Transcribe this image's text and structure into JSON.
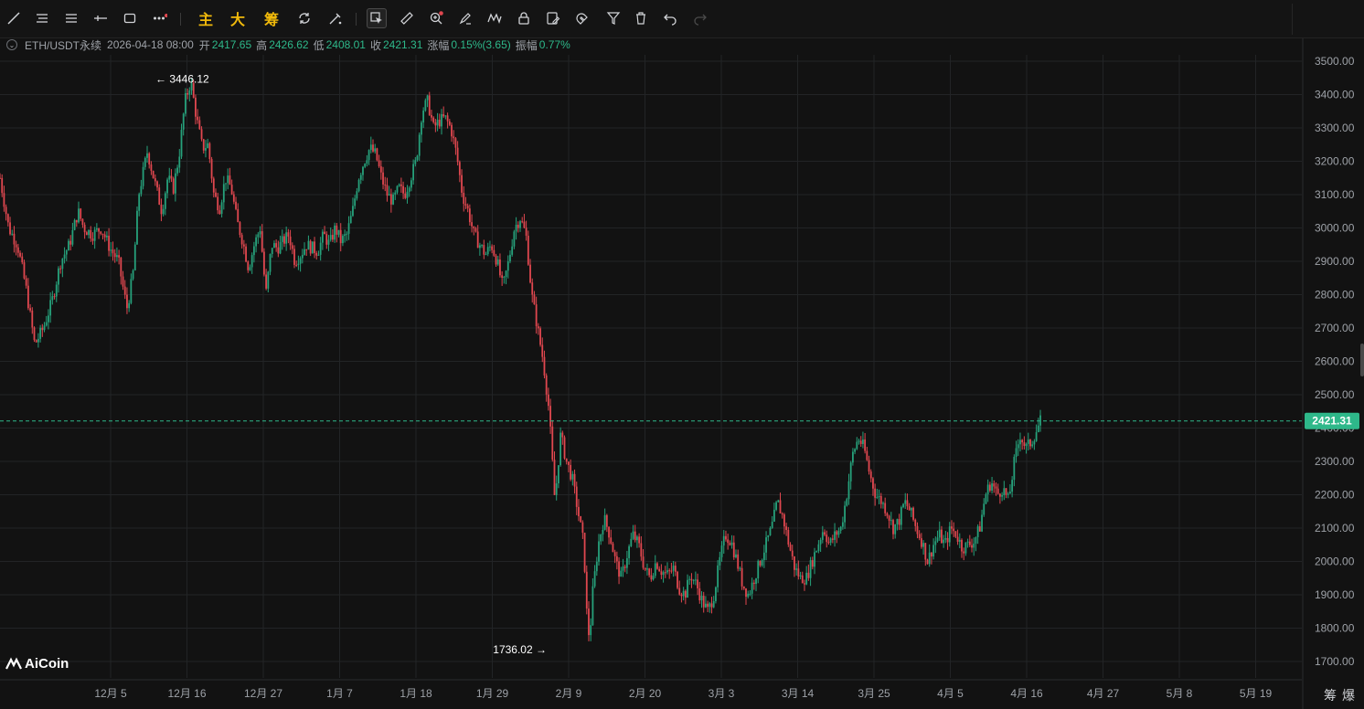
{
  "toolbar": {
    "tools": [
      {
        "name": "line-tool-icon"
      },
      {
        "name": "parallel-lines-icon"
      },
      {
        "name": "horizontal-lines-icon"
      },
      {
        "name": "horizontal-ray-icon"
      },
      {
        "name": "rectangle-icon"
      },
      {
        "name": "more-tools-icon"
      }
    ],
    "main_label": "主",
    "big_label": "大",
    "chip_label": "筹",
    "active_tool": "cursor-select-icon"
  },
  "info": {
    "symbol": "ETH/USDT永续",
    "datetime": "2026-04-18 08:00",
    "open_label": "开",
    "open": "2417.65",
    "high_label": "高",
    "high": "2426.62",
    "low_label": "低",
    "low": "2408.01",
    "close_label": "收",
    "close": "2421.31",
    "change_label": "涨幅",
    "change": "0.15%(3.65)",
    "amplitude_label": "振幅",
    "amplitude": "0.77%"
  },
  "logo_text": "AiCoin",
  "corner_labels": "筹爆",
  "colors": {
    "up": "#26a17b",
    "down": "#e0474f",
    "bg": "#121212",
    "grid": "#222426",
    "accent": "#2eb88a"
  },
  "chart_data": {
    "type": "candlestick",
    "y_axis": {
      "min": 1700,
      "max": 3500,
      "ticks": [
        "3500.00",
        "3400.00",
        "3300.00",
        "3200.00",
        "3100.00",
        "3000.00",
        "2900.00",
        "2800.00",
        "2700.00",
        "2600.00",
        "2500.00",
        "2400.00",
        "2300.00",
        "2200.00",
        "2100.00",
        "2000.00",
        "1900.00",
        "1800.00",
        "1700.00"
      ]
    },
    "x_axis": {
      "ticks": [
        "12月 5",
        "12月 16",
        "12月 27",
        "1月 7",
        "1月 18",
        "1月 29",
        "2月 9",
        "2月 20",
        "3月 3",
        "3月 14",
        "3月 25",
        "4月 5",
        "4月 16",
        "4月 27",
        "5月 8",
        "5月 19"
      ]
    },
    "last_price": "2421.31",
    "max_label": "3446.12",
    "min_label": "1736.02",
    "max_arrow": "←",
    "min_arrow": "→",
    "path": [
      [
        0,
        3150
      ],
      [
        3,
        3000
      ],
      [
        6,
        2950
      ],
      [
        9,
        2820
      ],
      [
        12,
        2650
      ],
      [
        15,
        2700
      ],
      [
        18,
        2780
      ],
      [
        21,
        2900
      ],
      [
        24,
        2950
      ],
      [
        27,
        3050
      ],
      [
        29,
        3000
      ],
      [
        32,
        2980
      ],
      [
        35,
        3000
      ],
      [
        38,
        2940
      ],
      [
        41,
        2900
      ],
      [
        43,
        2800
      ],
      [
        44,
        2760
      ],
      [
        46,
        2860
      ],
      [
        48,
        3100
      ],
      [
        51,
        3230
      ],
      [
        54,
        3120
      ],
      [
        56,
        3050
      ],
      [
        58,
        3150
      ],
      [
        60,
        3120
      ],
      [
        62,
        3220
      ],
      [
        64,
        3380
      ],
      [
        66,
        3440
      ],
      [
        68,
        3330
      ],
      [
        70,
        3240
      ],
      [
        72,
        3250
      ],
      [
        74,
        3100
      ],
      [
        76,
        3060
      ],
      [
        78,
        3150
      ],
      [
        80,
        3120
      ],
      [
        82,
        3020
      ],
      [
        84,
        2960
      ],
      [
        86,
        2880
      ],
      [
        88,
        2950
      ],
      [
        90,
        3000
      ],
      [
        92,
        2800
      ],
      [
        94,
        2950
      ],
      [
        96,
        2940
      ],
      [
        98,
        2960
      ],
      [
        100,
        2980
      ],
      [
        102,
        2900
      ],
      [
        104,
        2920
      ],
      [
        106,
        2950
      ],
      [
        108,
        2940
      ],
      [
        110,
        2930
      ],
      [
        112,
        2980
      ],
      [
        114,
        2950
      ],
      [
        116,
        3000
      ],
      [
        118,
        2960
      ],
      [
        120,
        2980
      ],
      [
        122,
        3050
      ],
      [
        124,
        3150
      ],
      [
        126,
        3200
      ],
      [
        128,
        3240
      ],
      [
        130,
        3220
      ],
      [
        132,
        3150
      ],
      [
        134,
        3100
      ],
      [
        136,
        3080
      ],
      [
        138,
        3120
      ],
      [
        140,
        3100
      ],
      [
        142,
        3150
      ],
      [
        144,
        3200
      ],
      [
        146,
        3350
      ],
      [
        148,
        3380
      ],
      [
        150,
        3300
      ],
      [
        152,
        3320
      ],
      [
        154,
        3330
      ],
      [
        156,
        3300
      ],
      [
        158,
        3220
      ],
      [
        160,
        3100
      ],
      [
        162,
        3050
      ],
      [
        164,
        2980
      ],
      [
        166,
        2950
      ],
      [
        168,
        2920
      ],
      [
        170,
        2950
      ],
      [
        172,
        2900
      ],
      [
        174,
        2820
      ],
      [
        176,
        2900
      ],
      [
        178,
        3000
      ],
      [
        180,
        3030
      ],
      [
        182,
        2980
      ],
      [
        184,
        2800
      ],
      [
        186,
        2700
      ],
      [
        188,
        2600
      ],
      [
        190,
        2450
      ],
      [
        192,
        2180
      ],
      [
        194,
        2380
      ],
      [
        196,
        2300
      ],
      [
        198,
        2250
      ],
      [
        200,
        2150
      ],
      [
        202,
        2050
      ],
      [
        203,
        1850
      ],
      [
        204,
        1760
      ],
      [
        205,
        1900
      ],
      [
        207,
        2050
      ],
      [
        209,
        2130
      ],
      [
        211,
        2080
      ],
      [
        213,
        2000
      ],
      [
        215,
        1950
      ],
      [
        217,
        2020
      ],
      [
        219,
        2080
      ],
      [
        221,
        2050
      ],
      [
        223,
        1980
      ],
      [
        225,
        1950
      ],
      [
        227,
        2000
      ],
      [
        229,
        1970
      ],
      [
        231,
        1960
      ],
      [
        233,
        1980
      ],
      [
        235,
        1920
      ],
      [
        237,
        1900
      ],
      [
        239,
        1960
      ],
      [
        241,
        1930
      ],
      [
        243,
        1880
      ],
      [
        245,
        1850
      ],
      [
        247,
        1900
      ],
      [
        249,
        2000
      ],
      [
        251,
        2080
      ],
      [
        253,
        2060
      ],
      [
        255,
        2000
      ],
      [
        257,
        1930
      ],
      [
        259,
        1900
      ],
      [
        261,
        1950
      ],
      [
        263,
        2000
      ],
      [
        265,
        2050
      ],
      [
        267,
        2100
      ],
      [
        269,
        2180
      ],
      [
        271,
        2130
      ],
      [
        273,
        2050
      ],
      [
        275,
        1980
      ],
      [
        277,
        1950
      ],
      [
        279,
        1950
      ],
      [
        281,
        2000
      ],
      [
        283,
        2050
      ],
      [
        285,
        2100
      ],
      [
        287,
        2050
      ],
      [
        289,
        2080
      ],
      [
        291,
        2100
      ],
      [
        293,
        2200
      ],
      [
        295,
        2320
      ],
      [
        297,
        2370
      ],
      [
        299,
        2340
      ],
      [
        301,
        2260
      ],
      [
        303,
        2200
      ],
      [
        305,
        2180
      ],
      [
        307,
        2150
      ],
      [
        309,
        2100
      ],
      [
        311,
        2120
      ],
      [
        313,
        2180
      ],
      [
        315,
        2150
      ],
      [
        317,
        2100
      ],
      [
        319,
        2060
      ],
      [
        321,
        2000
      ],
      [
        323,
        2050
      ],
      [
        325,
        2080
      ],
      [
        327,
        2050
      ],
      [
        329,
        2100
      ],
      [
        331,
        2080
      ],
      [
        333,
        2040
      ],
      [
        335,
        2050
      ],
      [
        337,
        2060
      ],
      [
        339,
        2100
      ],
      [
        341,
        2200
      ],
      [
        343,
        2240
      ],
      [
        345,
        2200
      ],
      [
        347,
        2220
      ],
      [
        349,
        2180
      ],
      [
        351,
        2300
      ],
      [
        353,
        2380
      ],
      [
        355,
        2340
      ],
      [
        357,
        2360
      ],
      [
        359,
        2400
      ],
      [
        360,
        2421
      ]
    ]
  }
}
